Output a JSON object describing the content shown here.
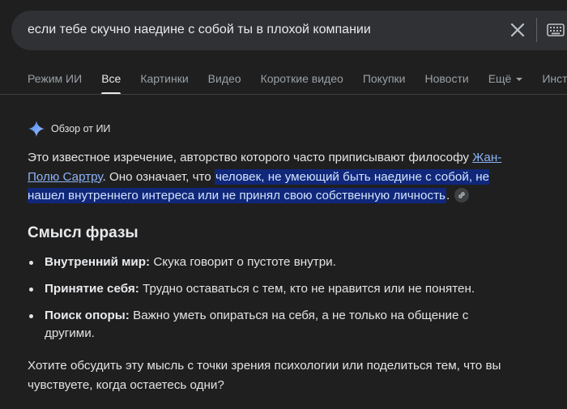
{
  "search": {
    "query": "если тебе скучно наедине с собой ты в плохой компании",
    "clear_icon": "close-icon",
    "keyboard_icon": "keyboard-icon"
  },
  "tabs": [
    {
      "label": "Режим ИИ",
      "active": false
    },
    {
      "label": "Все",
      "active": true
    },
    {
      "label": "Картинки",
      "active": false
    },
    {
      "label": "Видео",
      "active": false
    },
    {
      "label": "Короткие видео",
      "active": false
    },
    {
      "label": "Покупки",
      "active": false
    },
    {
      "label": "Новости",
      "active": false
    },
    {
      "label": "Ещё",
      "active": false,
      "dropdown": true
    },
    {
      "label": "Инструменты",
      "active": false
    }
  ],
  "ai_overview": {
    "title": "Обзор от ИИ",
    "icon": "sparkle-icon",
    "accent_color": "#8ab4f8",
    "intro_before_link": "Это известное изречение, авторство которого часто приписывают философу ",
    "link_text": "Жан-Полю Сартру",
    "intro_after_link": ". Оно означает, что ",
    "highlighted_text": "человек, не умеющий быть наедине с собой, не нашел внутреннего интереса или не принял свою собственную личность",
    "intro_end": ".",
    "highlight_color": "#10277a",
    "section_title": "Смысл фразы",
    "bullets": [
      {
        "term": "Внутренний мир:",
        "text": " Скука говорит о пустоте внутри."
      },
      {
        "term": "Принятие себя:",
        "text": " Трудно оставаться с тем, кто не нравится или не понятен."
      },
      {
        "term": "Поиск опоры:",
        "text": " Важно уметь опираться на себя, а не только на общение с другими."
      }
    ],
    "closing_text": "Хотите обсудить эту мысль с точки зрения психологии или поделиться тем, что вы чувствуете, когда остаетесь одни?"
  }
}
